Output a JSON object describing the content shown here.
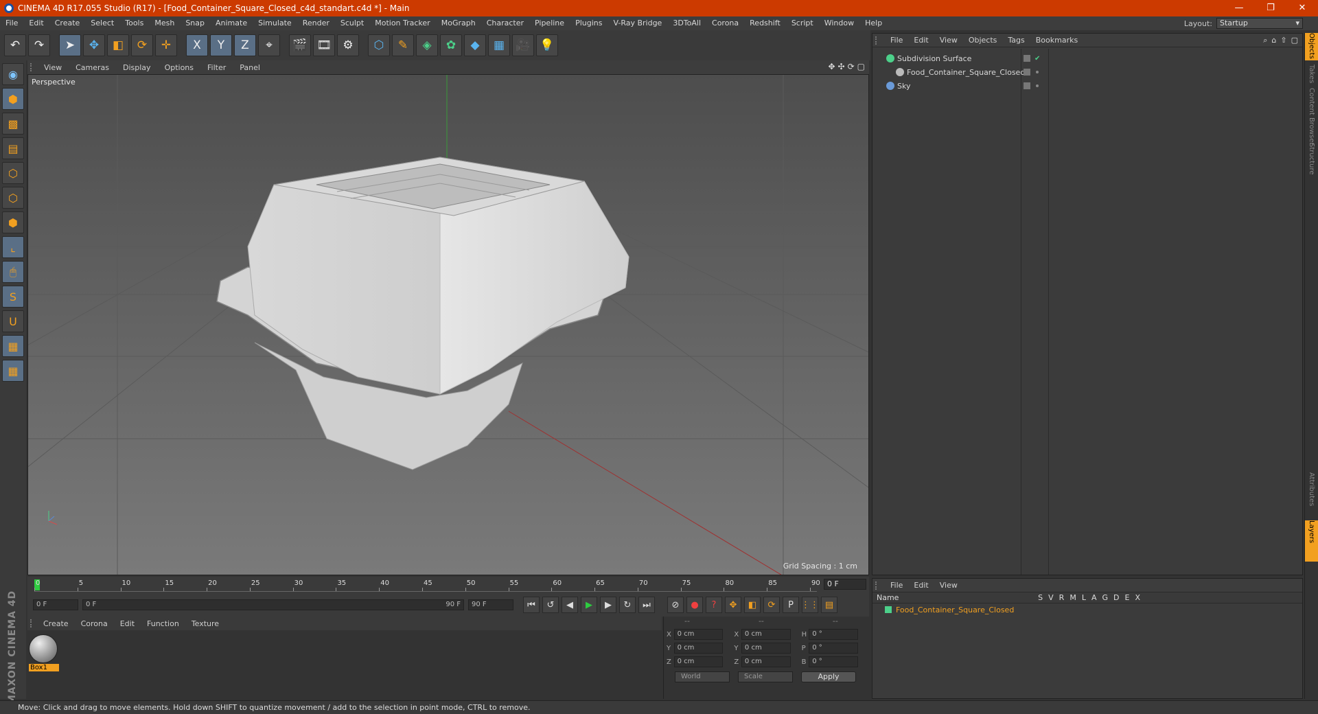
{
  "window": {
    "title": "CINEMA 4D R17.055 Studio (R17) - [Food_Container_Square_Closed_c4d_standart.c4d *] - Main",
    "controls": [
      "—",
      "❐",
      "✕"
    ]
  },
  "menubar": {
    "items": [
      "File",
      "Edit",
      "Create",
      "Select",
      "Tools",
      "Mesh",
      "Snap",
      "Animate",
      "Simulate",
      "Render",
      "Sculpt",
      "Motion Tracker",
      "MoGraph",
      "Character",
      "Pipeline",
      "Plugins",
      "V-Ray Bridge",
      "3DToAll",
      "Corona",
      "Redshift",
      "Script",
      "Window",
      "Help"
    ],
    "layout_label": "Layout:",
    "layout_value": "Startup"
  },
  "toolbar": {
    "buttons": [
      {
        "icon": "undo-icon",
        "glyph": "↶"
      },
      {
        "icon": "redo-icon",
        "glyph": "↷"
      },
      {
        "icon": "live-selection-icon",
        "glyph": "➤"
      },
      {
        "icon": "move-icon",
        "glyph": "✥"
      },
      {
        "icon": "scale-icon",
        "glyph": "◧"
      },
      {
        "icon": "rotate-icon",
        "glyph": "⟳"
      },
      {
        "icon": "recent-tool-icon",
        "glyph": "✛"
      },
      {
        "icon": "x-axis-icon",
        "glyph": "X"
      },
      {
        "icon": "y-axis-icon",
        "glyph": "Y"
      },
      {
        "icon": "z-axis-icon",
        "glyph": "Z"
      },
      {
        "icon": "coordinate-system-icon",
        "glyph": "⌖"
      },
      {
        "icon": "render-view-icon",
        "glyph": "🎬"
      },
      {
        "icon": "render-picture-viewer-icon",
        "glyph": "🎞"
      },
      {
        "icon": "render-settings-icon",
        "glyph": "⚙"
      },
      {
        "icon": "cube-object-icon",
        "glyph": "⬡"
      },
      {
        "icon": "pen-spline-icon",
        "glyph": "✎"
      },
      {
        "icon": "subdivision-surface-icon",
        "glyph": "◈"
      },
      {
        "icon": "cloner-icon",
        "glyph": "✿"
      },
      {
        "icon": "deformer-icon",
        "glyph": "◆"
      },
      {
        "icon": "floor-icon",
        "glyph": "▦"
      },
      {
        "icon": "camera-icon",
        "glyph": "🎥"
      },
      {
        "icon": "light-icon",
        "glyph": "💡"
      }
    ]
  },
  "left_toolbar": {
    "buttons": [
      {
        "icon": "make-editable-icon",
        "glyph": "◉"
      },
      {
        "icon": "model-mode-icon",
        "glyph": "⬢"
      },
      {
        "icon": "texture-mode-icon",
        "glyph": "▩"
      },
      {
        "icon": "workplane-mode-icon",
        "glyph": "▤"
      },
      {
        "icon": "points-mode-icon",
        "glyph": "⬡"
      },
      {
        "icon": "edges-mode-icon",
        "glyph": "⬡"
      },
      {
        "icon": "polygons-mode-icon",
        "glyph": "⬢"
      },
      {
        "icon": "axis-mode-icon",
        "glyph": "⌞"
      },
      {
        "icon": "tweak-mode-icon",
        "glyph": "🖱"
      },
      {
        "icon": "solo-icon",
        "glyph": "S"
      },
      {
        "icon": "snap-icon",
        "glyph": "U"
      },
      {
        "icon": "locked-workplane-icon",
        "glyph": "▦"
      },
      {
        "icon": "planar-workplane-icon",
        "glyph": "▦"
      }
    ],
    "logo": "MAXON CINEMA 4D"
  },
  "viewport": {
    "menu": [
      "View",
      "Cameras",
      "Display",
      "Options",
      "Filter",
      "Panel"
    ],
    "nav_icons": [
      "✥",
      "✣",
      "⟳",
      "▢"
    ],
    "camera_label": "Perspective",
    "grid_spacing": "Grid Spacing : 1 cm",
    "axis_labels": {
      "y": "y",
      "z": "z",
      "x": "x"
    }
  },
  "timeline": {
    "ticks": [
      "0",
      "5",
      "10",
      "15",
      "20",
      "25",
      "30",
      "35",
      "40",
      "45",
      "50",
      "55",
      "60",
      "65",
      "70",
      "75",
      "80",
      "85",
      "90"
    ],
    "current_frame": "0 F",
    "start_field": "0 F",
    "range_start": "0 F",
    "range_end": "90 F",
    "end_field": "90 F"
  },
  "transport": {
    "buttons": [
      {
        "icon": "go-to-start-icon",
        "glyph": "⏮",
        "tone": ""
      },
      {
        "icon": "prev-key-icon",
        "glyph": "↺",
        "tone": ""
      },
      {
        "icon": "prev-frame-icon",
        "glyph": "◀",
        "tone": ""
      },
      {
        "icon": "play-icon",
        "glyph": "▶",
        "tone": "gn"
      },
      {
        "icon": "next-frame-icon",
        "glyph": "▶",
        "tone": ""
      },
      {
        "icon": "next-key-icon",
        "glyph": "↻",
        "tone": ""
      },
      {
        "icon": "go-to-end-icon",
        "glyph": "⏭",
        "tone": ""
      }
    ],
    "key_buttons": [
      {
        "icon": "motion-record-icon",
        "glyph": "⊘",
        "tone": ""
      },
      {
        "icon": "record-active-icon",
        "glyph": "●",
        "tone": "rd"
      },
      {
        "icon": "autokey-icon",
        "glyph": "?",
        "tone": "rd"
      },
      {
        "icon": "key-position-icon",
        "glyph": "✥",
        "tone": "or"
      },
      {
        "icon": "key-scale-icon",
        "glyph": "◧",
        "tone": "or"
      },
      {
        "icon": "key-rotation-icon",
        "glyph": "⟳",
        "tone": "or"
      },
      {
        "icon": "key-param-icon",
        "glyph": "P",
        "tone": ""
      },
      {
        "icon": "key-pla-icon",
        "glyph": "⋮⋮",
        "tone": "or"
      },
      {
        "icon": "timeline-window-icon",
        "glyph": "▤",
        "tone": "or"
      }
    ]
  },
  "material_panel": {
    "menu": [
      "Create",
      "Corona",
      "Edit",
      "Function",
      "Texture"
    ],
    "materials": [
      {
        "name": "Box1"
      }
    ]
  },
  "coord_panel": {
    "headers": [
      "--",
      "--",
      "--"
    ],
    "rows": [
      {
        "a": "X",
        "av": "0 cm",
        "b": "X",
        "bv": "0 cm",
        "c": "H",
        "cv": "0 °"
      },
      {
        "a": "Y",
        "av": "0 cm",
        "b": "Y",
        "bv": "0 cm",
        "c": "P",
        "cv": "0 °"
      },
      {
        "a": "Z",
        "av": "0 cm",
        "b": "Z",
        "bv": "0 cm",
        "c": "B",
        "cv": "0 °"
      }
    ],
    "mode": "World",
    "type": "Scale",
    "apply": "Apply"
  },
  "object_manager": {
    "menu": [
      "File",
      "Edit",
      "View",
      "Objects",
      "Tags",
      "Bookmarks"
    ],
    "objects": [
      {
        "name": "Subdivision Surface",
        "color": "#4cd08a"
      },
      {
        "name": "Food_Container_Square_Closed",
        "color": "#bbbbbb"
      },
      {
        "name": "Sky",
        "color": "#6a9ad8"
      }
    ]
  },
  "layer_manager": {
    "menu": [
      "File",
      "Edit",
      "View"
    ],
    "col_name": "Name",
    "flags": [
      "S",
      "V",
      "R",
      "M",
      "L",
      "A",
      "G",
      "D",
      "E",
      "X"
    ],
    "layers": [
      {
        "name": "Food_Container_Square_Closed"
      }
    ]
  },
  "right_tabs": [
    "Objects",
    "Takes",
    "Content Browser",
    "Structure",
    "Attributes",
    "Layers"
  ],
  "status": "Move: Click and drag to move elements. Hold down SHIFT to quantize movement / add to the selection in point mode, CTRL to remove."
}
